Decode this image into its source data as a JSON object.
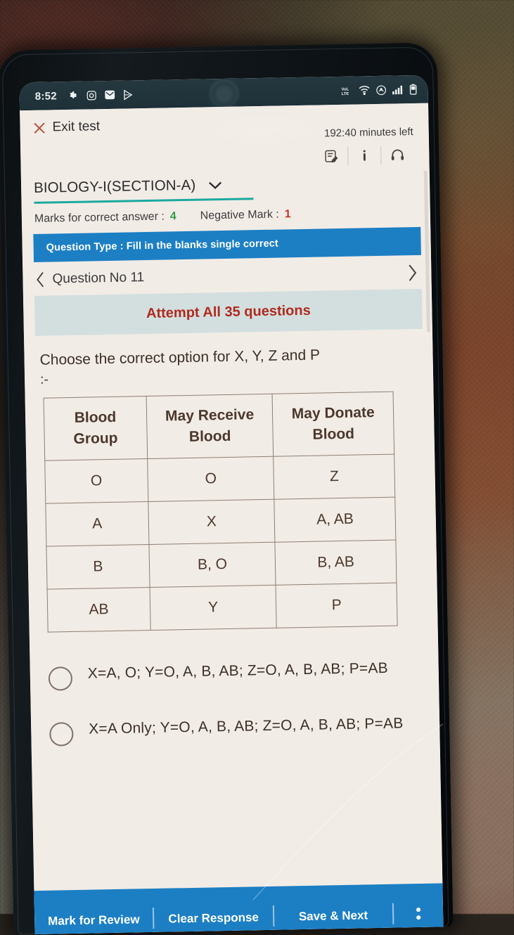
{
  "status_bar": {
    "time": "8:52",
    "left_icons": [
      "settings-gear-icon",
      "instagram-icon",
      "mail-icon",
      "play-store-icon"
    ],
    "right_icons": [
      "volte-icon",
      "wifi-icon",
      "vibrate-icon",
      "signal-bars-icon",
      "battery-icon"
    ]
  },
  "header": {
    "exit_label": "Exit test",
    "timer": "192:40 minutes left",
    "icons": [
      "note-edit-icon",
      "info-icon",
      "headset-support-icon"
    ]
  },
  "section": {
    "name": "BIOLOGY-I(SECTION-A)",
    "chevron": "chevron-down-icon",
    "marks_label": "Marks for correct answer :",
    "marks_value": "4",
    "negative_label": "Negative Mark :",
    "negative_value": "1",
    "question_type": "Question Type : Fill in the blanks single correct"
  },
  "question_nav": {
    "prev_icon": "chevron-left-icon",
    "label": "Question No 11",
    "next_icon": "chevron-right-icon"
  },
  "attempt_banner": "Attempt All 35 questions",
  "question": {
    "text": "Choose the correct option for X, Y, Z and P",
    "colon": ":-"
  },
  "table": {
    "headers": [
      "Blood Group",
      "May Receive Blood",
      "May Donate Blood"
    ],
    "headers_split": [
      [
        "Blood",
        "Group"
      ],
      [
        "May Receive",
        "Blood"
      ],
      [
        "May Donate",
        "Blood"
      ]
    ],
    "rows": [
      [
        "O",
        "O",
        "Z"
      ],
      [
        "A",
        "X",
        "A, AB"
      ],
      [
        "B",
        "B, O",
        "B, AB"
      ],
      [
        "AB",
        "Y",
        "P"
      ]
    ]
  },
  "options": [
    {
      "id": "option-1",
      "text": "X=A, O; Y=O, A, B, AB;  Z=O, A, B, AB; P=AB",
      "selected": false
    },
    {
      "id": "option-2",
      "text": "X=A Only; Y=O, A, B, AB; Z=O, A, B, AB; P=AB",
      "selected": false
    }
  ],
  "bottom_bar": {
    "mark_for_review": "Mark for Review",
    "clear_response": "Clear Response",
    "save_next": "Save & Next",
    "more_icon": "more-vertical-icon"
  },
  "colors": {
    "accent_blue": "#1c7fc4",
    "teal_underline": "#1aa9a0",
    "banner_bg": "#d3dfdf",
    "banner_text": "#b02a1e",
    "positive_mark": "#2f9e44",
    "negative_mark": "#c0392b",
    "screen_bg": "#f2ece6",
    "table_border": "#8d7f72"
  }
}
